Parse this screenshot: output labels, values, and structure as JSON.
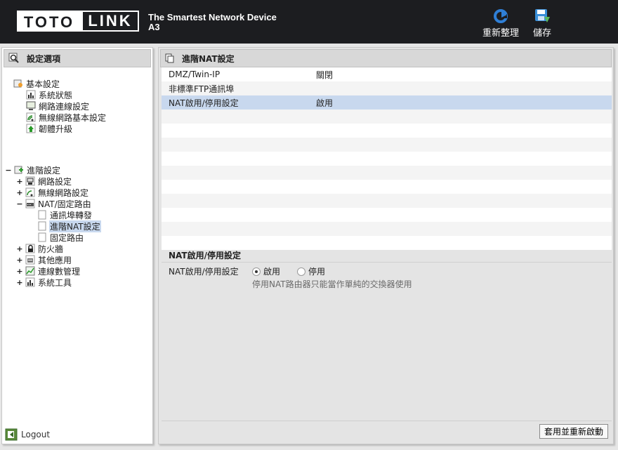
{
  "header": {
    "logo_left": "TOTO",
    "logo_right": "LINK",
    "tagline_line1": "The Smartest Network Device",
    "tagline_line2": "A3",
    "refresh_label": "重新整理",
    "save_label": "儲存"
  },
  "sidebar": {
    "title": "設定選項",
    "basic": {
      "label": "基本設定",
      "items": [
        "系統狀態",
        "網路連線設定",
        "無線網路基本設定",
        "韌體升級"
      ]
    },
    "advanced": {
      "toggle": "−",
      "label": "進階設定",
      "items": [
        {
          "toggle": "+",
          "label": "網路設定"
        },
        {
          "toggle": "+",
          "label": "無線網路設定"
        },
        {
          "toggle": "−",
          "label": "NAT/固定路由"
        },
        {
          "toggle": "+",
          "label": "防火牆"
        },
        {
          "toggle": "+",
          "label": "其他應用"
        },
        {
          "toggle": "+",
          "label": "連線數管理"
        },
        {
          "toggle": "+",
          "label": "系統工具"
        }
      ],
      "nat_children": [
        "通訊埠轉發",
        "進階NAT設定",
        "固定路由"
      ],
      "selected": "進階NAT設定"
    },
    "logout_label": "Logout"
  },
  "main": {
    "title": "進階NAT設定",
    "rows": [
      {
        "name": "DMZ/Twin-IP",
        "value": "關閉"
      },
      {
        "name": "非標準FTP通訊埠",
        "value": ""
      },
      {
        "name": "NAT啟用/停用設定",
        "value": "啟用",
        "selected": true
      }
    ],
    "empty_rows": 10,
    "section_title": "NAT啟用/停用設定",
    "option_label": "NAT啟用/停用設定",
    "radio_on": "啟用",
    "radio_off": "停用",
    "selected_radio": "啟用",
    "hint": "停用NAT路由器只能當作單純的交換器使用",
    "apply_label": "套用並重新啟動"
  },
  "colors": {
    "header_bg": "#1c1d20",
    "selection": "#c8d8ee",
    "refresh_icon": "#2f7fd6",
    "save_icon": "#3a8fd8"
  }
}
